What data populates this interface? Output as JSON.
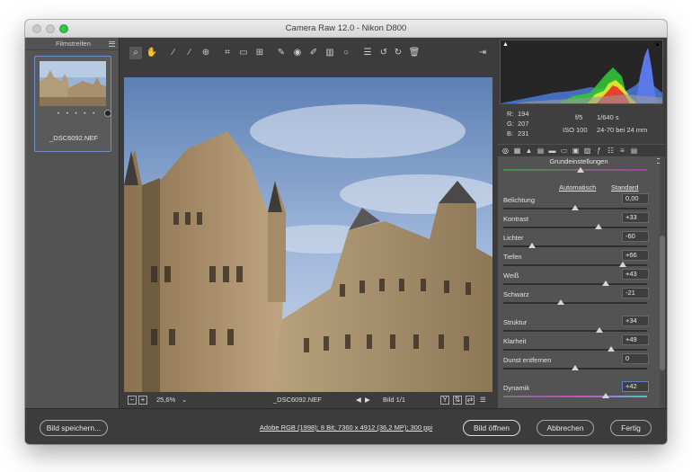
{
  "window": {
    "title": "Camera Raw 12.0 - Nikon D800"
  },
  "filmstrip": {
    "title": "Filmstreifen",
    "items": [
      {
        "filename": "_DSC6092.NEF",
        "rating": "• • • • •"
      }
    ]
  },
  "toolbar": {
    "tools": [
      "zoom-icon",
      "hand-icon",
      "white-balance-icon",
      "color-sampler-icon",
      "targeted-adjustment-icon",
      "crop-icon",
      "straighten-icon",
      "transform-icon",
      "spot-removal-icon",
      "red-eye-icon",
      "adjustment-brush-icon",
      "graduated-filter-icon",
      "radial-filter-icon",
      "presets-list-icon",
      "rotate-left-icon",
      "rotate-right-icon",
      "trash-icon"
    ]
  },
  "statusbar": {
    "zoom": "25,6%",
    "filename": "_DSC6092.NEF",
    "image_counter": "Bild 1/1"
  },
  "readout": {
    "r_label": "R:",
    "r": "194",
    "g_label": "G:",
    "g": "207",
    "b_label": "B:",
    "b": "231",
    "aperture": "f/5",
    "shutter": "1/640 s",
    "iso": "ISO 100",
    "lens": "24-70 bei 24 mm"
  },
  "panel": {
    "title": "Grundeinstellungen",
    "auto_label": "Automatisch",
    "default_label": "Standard",
    "sliders": [
      {
        "label": "Belichtung",
        "value": "0,00",
        "pos": 0.5
      },
      {
        "label": "Kontrast",
        "value": "+33",
        "pos": 0.66
      },
      {
        "label": "Lichter",
        "value": "-60",
        "pos": 0.2
      },
      {
        "label": "Tiefen",
        "value": "+66",
        "pos": 0.83
      },
      {
        "label": "Weiß",
        "value": "+43",
        "pos": 0.71
      },
      {
        "label": "Schwarz",
        "value": "-21",
        "pos": 0.4
      },
      {
        "label": "Struktur",
        "value": "+34",
        "pos": 0.67
      },
      {
        "label": "Klarheit",
        "value": "+49",
        "pos": 0.75
      },
      {
        "label": "Dunst entfernen",
        "value": "0",
        "pos": 0.5
      },
      {
        "label": "Dynamik",
        "value": "+42",
        "pos": 0.71
      }
    ]
  },
  "bottom": {
    "save_label": "Bild speichern...",
    "workflow": "Adobe RGB (1998); 8 Bit; 7360 x 4912 (36,2 MP); 300 ppi",
    "open_label": "Bild öffnen",
    "cancel_label": "Abbrechen",
    "done_label": "Fertig"
  },
  "colors": {
    "accent": "#5b82c4",
    "window_bg": "#3c3c3c",
    "panel_bg": "#535353"
  }
}
